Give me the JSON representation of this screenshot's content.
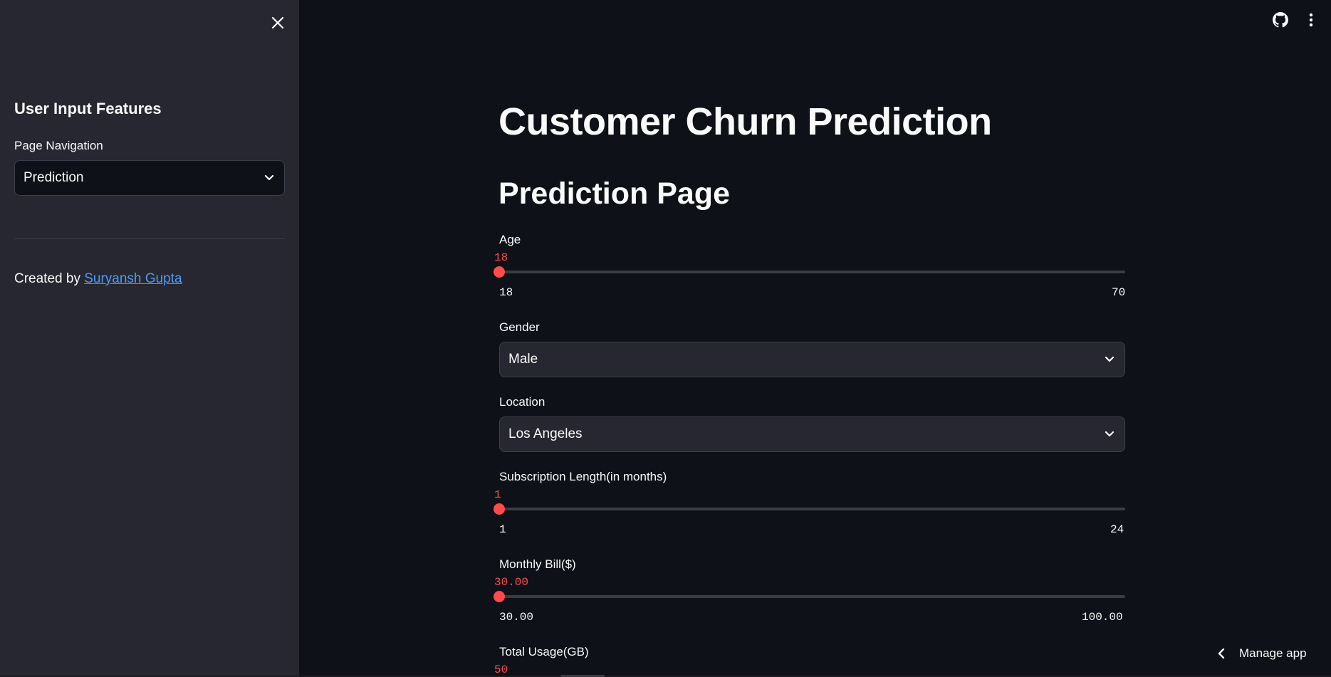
{
  "sidebar": {
    "title": "User Input Features",
    "nav_label": "Page Navigation",
    "nav_value": "Prediction",
    "credit_prefix": "Created by ",
    "credit_link": "Suryansh Gupta"
  },
  "main": {
    "title": "Customer Churn Prediction",
    "subtitle": "Prediction Page",
    "age": {
      "label": "Age",
      "value": "18",
      "min": "18",
      "max": "70",
      "fraction": 0
    },
    "gender": {
      "label": "Gender",
      "value": "Male"
    },
    "location": {
      "label": "Location",
      "value": "Los Angeles"
    },
    "subscription": {
      "label": "Subscription Length(in months)",
      "value": "1",
      "min": "1",
      "max": "24",
      "fraction": 0
    },
    "bill": {
      "label": "Monthly Bill($)",
      "value": "30.00",
      "min": "30.00",
      "max": "100.00",
      "fraction": 0
    },
    "usage": {
      "label": "Total Usage(GB)",
      "value": "50"
    }
  },
  "footer": {
    "manage_app": "Manage app"
  },
  "colors": {
    "accent": "#ff4b4b",
    "link": "#4a9df8",
    "sidebar_bg": "#262730",
    "main_bg": "#0e1117"
  },
  "icons": [
    "close-icon",
    "github-icon",
    "kebab-menu-icon",
    "chevron-down-icon",
    "chevron-left-icon"
  ]
}
